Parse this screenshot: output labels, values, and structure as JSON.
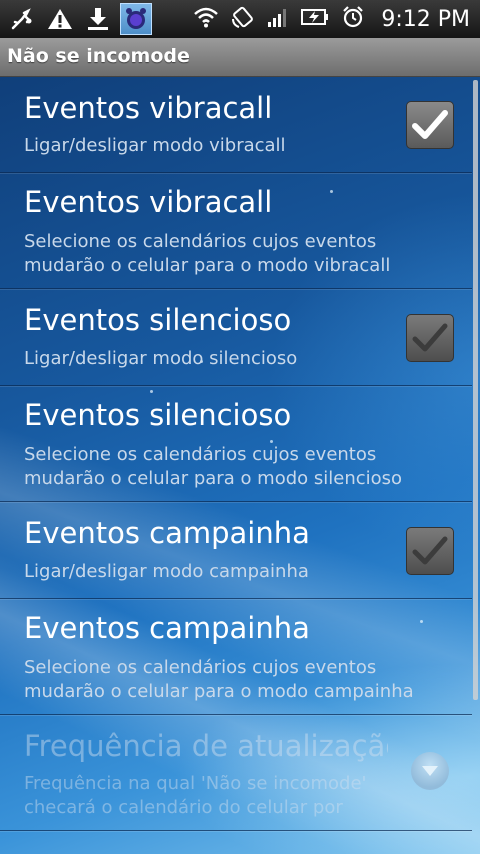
{
  "status_bar": {
    "time": "9:12 PM",
    "left_icons": [
      "usb-debug-icon",
      "warning-icon",
      "download-icon",
      "alarm-app-icon"
    ],
    "right_icons": [
      "wifi-icon",
      "rotation-icon",
      "signal-icon",
      "battery-charging-icon",
      "alarm-clock-icon"
    ]
  },
  "title_bar": {
    "title": "Não se incomode"
  },
  "preferences": [
    {
      "title": "Eventos vibracall",
      "summary_lines": [
        "Ligar/desligar modo vibracall"
      ],
      "widget": "checkbox",
      "checked": true,
      "enabled": true
    },
    {
      "title": "Eventos vibracall",
      "summary_lines": [
        "Selecione os calendários cujos eventos",
        "mudarão o celular para o modo vibracall"
      ],
      "widget": "none",
      "enabled": true
    },
    {
      "title": "Eventos silencioso",
      "summary_lines": [
        "Ligar/desligar modo silencioso"
      ],
      "widget": "checkbox",
      "checked": false,
      "enabled": true
    },
    {
      "title": "Eventos silencioso",
      "summary_lines": [
        "Selecione os calendários cujos eventos",
        "mudarão o celular para o modo silencioso"
      ],
      "widget": "none",
      "enabled": true
    },
    {
      "title": "Eventos campainha",
      "summary_lines": [
        "Ligar/desligar modo campainha"
      ],
      "widget": "checkbox",
      "checked": false,
      "enabled": true
    },
    {
      "title": "Eventos campainha",
      "summary_lines": [
        "Selecione os calendários cujos eventos",
        "mudarão o celular para o modo campainha"
      ],
      "widget": "none",
      "enabled": true
    },
    {
      "title": "Frequência de atualização",
      "summary_lines": [
        "Frequência na qual 'Não se incomode'",
        "checará o calendário do celular por"
      ],
      "widget": "dropdown",
      "enabled": false
    }
  ],
  "colors": {
    "accent_blue": "#1f72c0",
    "title_bar": "#8a8a8a",
    "check_green": "#ffffff"
  }
}
